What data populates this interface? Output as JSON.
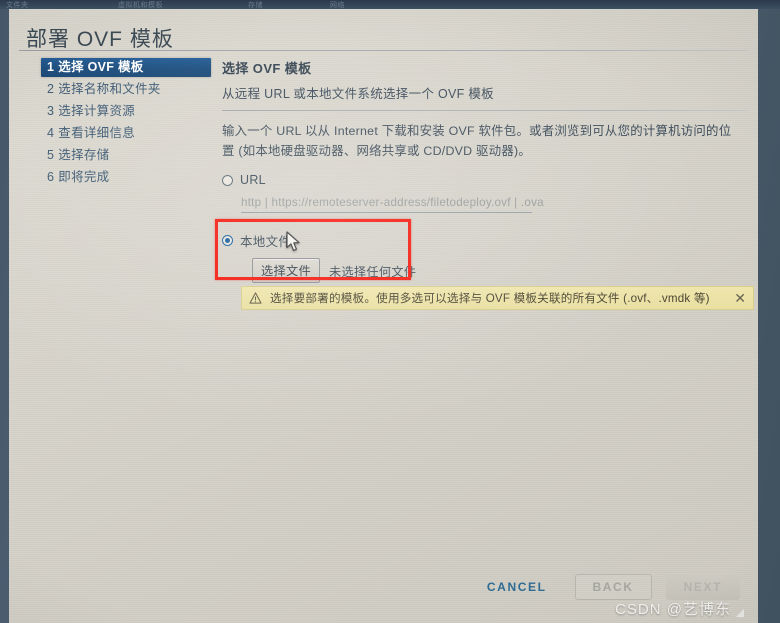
{
  "window": {
    "title": "部署 OVF 模板"
  },
  "background_taskbar": {
    "ghost_items": [
      "文件夹",
      "虚拟机和模板",
      "存储",
      "网络"
    ]
  },
  "sidebar": {
    "steps": [
      {
        "num": "1",
        "label": "选择 OVF 模板",
        "active": true
      },
      {
        "num": "2",
        "label": "选择名称和文件夹",
        "active": false
      },
      {
        "num": "3",
        "label": "选择计算资源",
        "active": false
      },
      {
        "num": "4",
        "label": "查看详细信息",
        "active": false
      },
      {
        "num": "5",
        "label": "选择存储",
        "active": false
      },
      {
        "num": "6",
        "label": "即将完成",
        "active": false
      }
    ]
  },
  "main": {
    "title": "选择 OVF 模板",
    "subtitle": "从远程 URL 或本地文件系统选择一个 OVF 模板",
    "description": "输入一个 URL 以从 Internet 下载和安装 OVF 软件包。或者浏览到可从您的计算机访问的位置 (如本地硬盘驱动器、网络共享或 CD/DVD 驱动器)。",
    "url_option": {
      "label": "URL",
      "selected": false,
      "placeholder": "http | https://remoteserver-address/filetodeploy.ovf | .ova",
      "value": ""
    },
    "local_option": {
      "label": "本地文件",
      "selected": true,
      "choose_file_label": "选择文件",
      "no_file_label": "未选择任何文件"
    },
    "warning": {
      "icon": "warning-triangle-icon",
      "text": "选择要部署的模板。使用多选可以选择与 OVF 模板关联的所有文件 (.ovf、.vmdk 等)",
      "close_icon": "close-icon"
    }
  },
  "annotation": {
    "color": "#f41a10",
    "shape": "rectangle"
  },
  "cursor": {
    "icon": "mouse-pointer-icon"
  },
  "footer": {
    "cancel_label": "CANCEL",
    "back_label": "BACK",
    "next_label": "NEXT",
    "back_disabled": true,
    "next_disabled": true
  },
  "watermark": {
    "text": "CSDN @艺博东"
  },
  "colors": {
    "accent_blue": "#1b5f9e",
    "active_step_bg": "#1d4f80",
    "link_blue": "#2f6b92",
    "warning_bg": "#e9dfa1",
    "annotation_red": "#f41a10"
  }
}
